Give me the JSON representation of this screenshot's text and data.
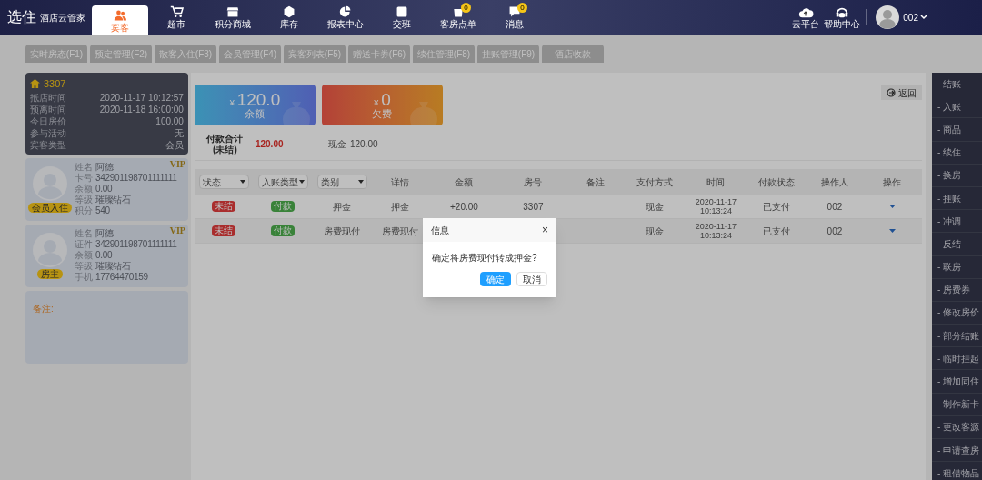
{
  "header": {
    "logo": {
      "mark": "选住",
      "name": "酒店云管家"
    },
    "nav": [
      {
        "label": "宾客",
        "selected": true
      },
      {
        "label": "超市",
        "selected": false
      },
      {
        "label": "积分商城",
        "selected": false
      },
      {
        "label": "库存",
        "selected": false
      },
      {
        "label": "报表中心",
        "selected": false
      },
      {
        "label": "交班",
        "selected": false
      },
      {
        "label": "客房点单",
        "selected": false,
        "badge": "0"
      },
      {
        "label": "消息",
        "selected": false,
        "badge": "0"
      }
    ],
    "tools": [
      {
        "label": "云平台"
      },
      {
        "label": "帮助中心"
      }
    ],
    "user": {
      "name": "002"
    }
  },
  "tabs": [
    {
      "label": "实时房态(F1)"
    },
    {
      "label": "预定管理(F2)"
    },
    {
      "label": "散客入住(F3)"
    },
    {
      "label": "会员管理(F4)"
    },
    {
      "label": "宾客列表(F5)"
    },
    {
      "label": "赠送卡券(F6)"
    },
    {
      "label": "续住管理(F8)"
    },
    {
      "label": "挂账管理(F9)"
    },
    {
      "label": "酒店收款"
    }
  ],
  "room": {
    "number": "3307",
    "fields": [
      {
        "label": "抵店时间",
        "value": "2020-11-17 10:12:57"
      },
      {
        "label": "预离时间",
        "value": "2020-11-18 16:00:00"
      },
      {
        "label": "今日房价",
        "value": "100.00"
      },
      {
        "label": "参与活动",
        "value": "无"
      },
      {
        "label": "宾客类型",
        "value": "会员"
      }
    ]
  },
  "guests": [
    {
      "badge": "会员入住",
      "vip": "VIP",
      "fields": [
        {
          "label": "姓名",
          "value": "阿德"
        },
        {
          "label": "卡号",
          "value": "342901198701111111"
        },
        {
          "label": "余额",
          "value": "0.00"
        },
        {
          "label": "等级",
          "value": "璀璨钻石"
        },
        {
          "label": "积分",
          "value": "540"
        }
      ]
    },
    {
      "badge": "房主",
      "vip": "VIP",
      "fields": [
        {
          "label": "姓名",
          "value": "阿德"
        },
        {
          "label": "证件",
          "value": "342901198701111111"
        },
        {
          "label": "余额",
          "value": "0.00"
        },
        {
          "label": "等级",
          "value": "璀璨钻石"
        },
        {
          "label": "手机",
          "value": "17764470159"
        }
      ]
    }
  ],
  "remark": {
    "label": "备注:"
  },
  "summary_cards": [
    {
      "kind": "balance",
      "currency": "¥",
      "amount": "120.0",
      "label": "余额"
    },
    {
      "kind": "debt",
      "currency": "¥",
      "amount": "0",
      "label": "欠费"
    }
  ],
  "back_button": "返回",
  "totals": {
    "label": "付款合计",
    "sublabel": "(未结)",
    "amount": "120.00",
    "method": "现金",
    "method_amount": "120.00"
  },
  "table": {
    "columns": [
      {
        "label": "状态",
        "kind": "filter"
      },
      {
        "label": "入账类型",
        "kind": "filter"
      },
      {
        "label": "类别",
        "kind": "filter"
      },
      {
        "label": "详情",
        "kind": "text"
      },
      {
        "label": "金额",
        "kind": "text"
      },
      {
        "label": "房号",
        "kind": "text"
      },
      {
        "label": "备注",
        "kind": "text"
      },
      {
        "label": "支付方式",
        "kind": "text"
      },
      {
        "label": "时间",
        "kind": "text"
      },
      {
        "label": "付款状态",
        "kind": "text"
      },
      {
        "label": "操作人",
        "kind": "text"
      },
      {
        "label": "操作",
        "kind": "text"
      }
    ],
    "rows": [
      {
        "status": "未结",
        "type": "付款",
        "category": "押金",
        "detail": "押金",
        "amount": "+20.00",
        "room": "3307",
        "method": "现金",
        "date": "2020-11-17",
        "time": "10:13:24",
        "pay_status": "已支付",
        "operator": "002"
      },
      {
        "status": "未结",
        "type": "付款",
        "category": "房费现付",
        "detail": "房费现付",
        "method": "现金",
        "date": "2020-11-17",
        "time": "10:13:24",
        "pay_status": "已支付",
        "operator": "002"
      }
    ]
  },
  "actions": [
    "- 结账",
    "- 入账",
    "- 商品",
    "- 续住",
    "- 换房",
    "- 挂账",
    "- 冲调",
    "- 反结",
    "- 联房",
    "- 房费券",
    "- 修改房价",
    "- 部分结账",
    "- 临时挂起",
    "- 增加同住",
    "- 制作新卡",
    "- 更改客源",
    "- 申请查房",
    "- 租借物品"
  ],
  "dialog": {
    "title": "信息",
    "close": "×",
    "message": "确定将房费现付转成押金?",
    "buttons": [
      {
        "label": "确定",
        "primary": true
      },
      {
        "label": "取消",
        "primary": false
      }
    ]
  }
}
